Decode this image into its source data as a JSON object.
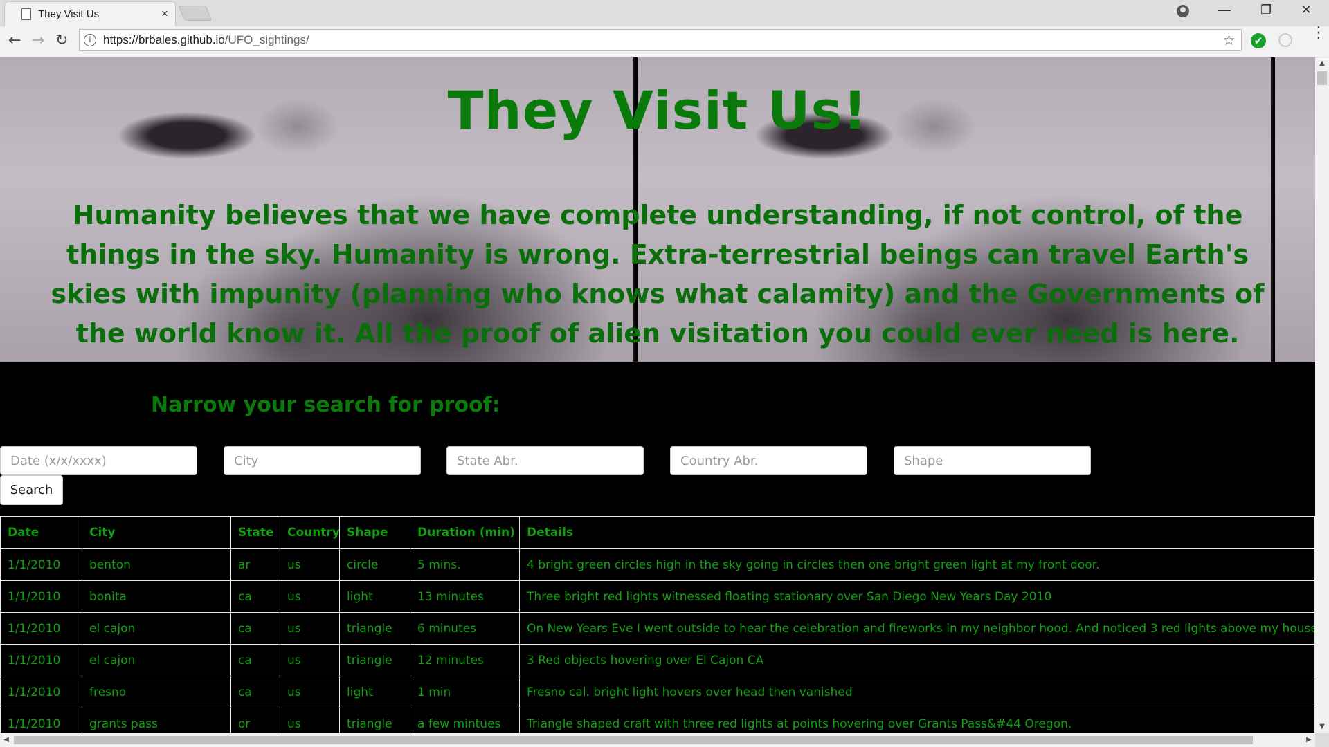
{
  "browser": {
    "tab_title": "They Visit Us",
    "tab_close": "×",
    "url_domain": "https://brbales.github.io",
    "url_path": "/UFO_sightings/",
    "info_symbol": "i",
    "star_symbol": "☆",
    "back_symbol": "←",
    "forward_symbol": "→",
    "reload_symbol": "↻",
    "minimize_symbol": "—",
    "restore_symbol": "❐",
    "close_symbol": "✕",
    "ext_check_symbol": "✔",
    "menu_symbol": "⋮"
  },
  "hero": {
    "title": "They Visit Us!",
    "text": "Humanity believes that we have complete understanding, if not control, of the things in the sky. Humanity is wrong. Extra-terrestrial beings can travel Earth's skies with impunity (planning who knows what calamity) and the Governments of the world know it. All the proof of alien visitation you could ever need is here."
  },
  "filters": {
    "heading": "Narrow your search for proof:",
    "date_placeholder": "Date (x/x/xxxx)",
    "city_placeholder": "City",
    "state_placeholder": "State Abr.",
    "country_placeholder": "Country Abr.",
    "shape_placeholder": "Shape",
    "search_label": "Search"
  },
  "table": {
    "headers": [
      "Date",
      "City",
      "State",
      "Country",
      "Shape",
      "Duration (min)",
      "Details"
    ],
    "rows": [
      [
        "1/1/2010",
        "benton",
        "ar",
        "us",
        "circle",
        "5 mins.",
        "4 bright green circles high in the sky going in circles then one bright green light at my front door."
      ],
      [
        "1/1/2010",
        "bonita",
        "ca",
        "us",
        "light",
        "13 minutes",
        "Three bright red lights witnessed floating stationary over San Diego New Years Day 2010"
      ],
      [
        "1/1/2010",
        "el cajon",
        "ca",
        "us",
        "triangle",
        "6 minutes",
        "On New Years Eve I went outside to hear the celebration and fireworks in my neighbor hood. And noticed 3 red lights above my house and"
      ],
      [
        "1/1/2010",
        "el cajon",
        "ca",
        "us",
        "triangle",
        "12 minutes",
        "3 Red objects hovering over El Cajon CA"
      ],
      [
        "1/1/2010",
        "fresno",
        "ca",
        "us",
        "light",
        "1 min",
        "Fresno cal. bright light hovers over head then vanished"
      ],
      [
        "1/1/2010",
        "grants pass",
        "or",
        "us",
        "triangle",
        "a few mintues",
        "Triangle shaped craft with three red lights at points hovering over Grants Pass&#44 Oregon."
      ]
    ]
  },
  "colors": {
    "accent_green": "#0a7a0a",
    "table_text_green": "#12a012",
    "background": "#000000"
  }
}
